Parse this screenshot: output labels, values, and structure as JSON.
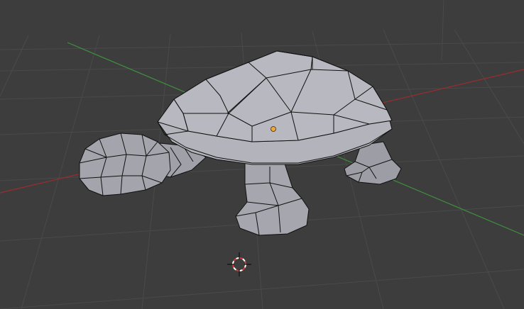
{
  "viewport": {
    "background": "#3d3d3d",
    "grid_color": "#4a4a4a",
    "x_axis_color": "#9a2d2d",
    "y_axis_color": "#3f8f3f"
  },
  "model": {
    "object": "turtle",
    "fill": "#a8a8b0",
    "fill_light": "#b9b9c1",
    "fill_dark": "#8d8d95",
    "edge_color": "#111111"
  },
  "origin_marker": {
    "color": "#f2a53a"
  },
  "cursor_3d": {
    "icon": "3d-cursor-icon",
    "ring_colors": [
      "#d43c3c",
      "#ffffff"
    ]
  }
}
